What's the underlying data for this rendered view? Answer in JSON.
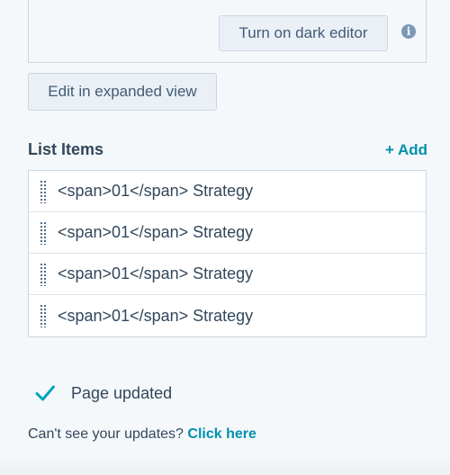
{
  "editor": {
    "dark_editor_label": "Turn on dark editor",
    "info_icon": "info-icon"
  },
  "expanded_view_label": "Edit in expanded view",
  "list": {
    "title": "List Items",
    "add_label": "+ Add",
    "items": [
      {
        "label": "<span>01</span> Strategy"
      },
      {
        "label": "<span>01</span> Strategy"
      },
      {
        "label": "<span>01</span> Strategy"
      },
      {
        "label": "<span>01</span> Strategy"
      }
    ]
  },
  "status": {
    "icon": "check-icon",
    "text": "Page updated"
  },
  "help": {
    "text": "Can't see your updates?",
    "link": "Click here"
  },
  "colors": {
    "accent": "#0091ae",
    "check": "#00a4bd",
    "text": "#33475b",
    "border": "#cbd6e2",
    "button_bg": "#eaf0f6"
  }
}
